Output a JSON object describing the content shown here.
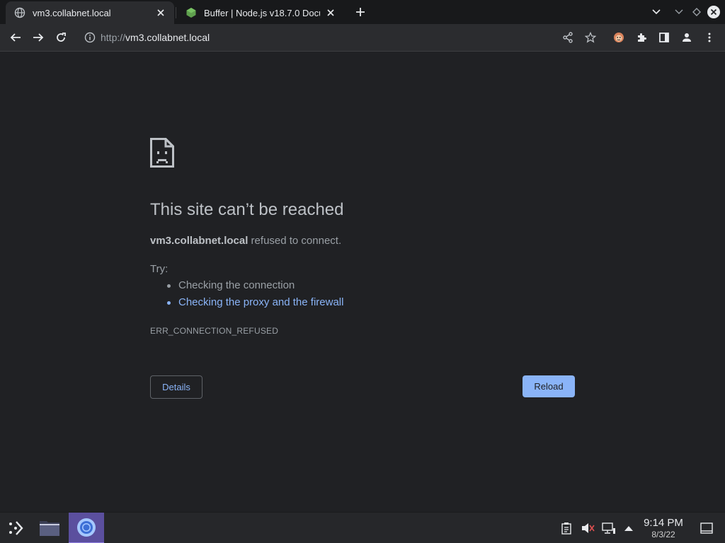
{
  "tabs": [
    {
      "title": "vm3.collabnet.local",
      "favicon": "globe-icon",
      "active": true
    },
    {
      "title": "Buffer | Node.js v18.7.0 Docu",
      "favicon": "nodejs-icon",
      "active": false
    }
  ],
  "toolbar": {
    "url_scheme": "http://",
    "url_host": "vm3.collabnet.local"
  },
  "error": {
    "title": "This site can’t be reached",
    "host": "vm3.collabnet.local",
    "summary_suffix": " refused to connect.",
    "try_label": "Try:",
    "suggestions": [
      {
        "text": "Checking the connection",
        "link": false
      },
      {
        "text": "Checking the proxy and the firewall",
        "link": true
      }
    ],
    "code": "ERR_CONNECTION_REFUSED",
    "details_label": "Details",
    "reload_label": "Reload"
  },
  "taskbar": {
    "time": "9:14 PM",
    "date": "8/3/22"
  },
  "colors": {
    "background": "#202124",
    "link": "#8ab4f8",
    "reload_button": "#8ab4f8",
    "taskbar_active": "#5b4f9e"
  }
}
